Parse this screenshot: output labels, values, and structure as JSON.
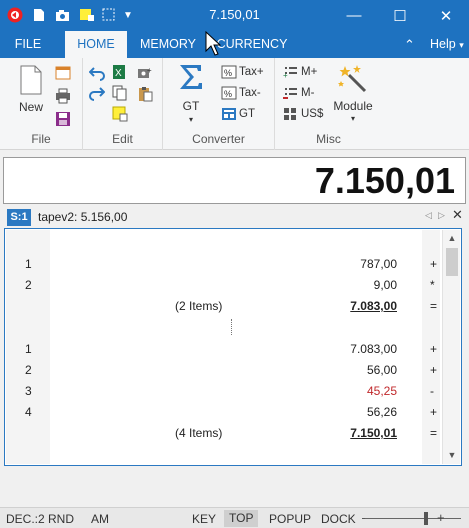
{
  "window": {
    "title": "7.150,01",
    "minimize": "—",
    "maximize": "☐",
    "close": "✕"
  },
  "quick_access": [
    "new-doc",
    "camera",
    "sticky-note",
    "select",
    "dropdown"
  ],
  "menu": {
    "tabs": [
      {
        "label": "FILE",
        "active": false
      },
      {
        "label": "HOME",
        "active": true
      },
      {
        "label": "MEMORY",
        "active": false
      },
      {
        "label": "CURRENCY",
        "active": false
      }
    ],
    "collapse_glyph": "⌃",
    "help": "Help",
    "help_caret": "▾"
  },
  "ribbon": {
    "file": {
      "label": "File",
      "new_label": "New"
    },
    "edit": {
      "label": "Edit"
    },
    "converter": {
      "label": "Converter",
      "gt_label": "GT",
      "caret": "▾",
      "tax_plus": "Tax+",
      "tax_minus": "Tax-",
      "gt_small": "GT"
    },
    "misc": {
      "label": "Misc",
      "m_plus": "M+",
      "m_minus": "M-",
      "uss": "US$",
      "module_label": "Module",
      "caret": "▾"
    }
  },
  "display": {
    "value": "7.150,01"
  },
  "tape": {
    "badge": "S:1",
    "name": "tapev2: 5.156,00",
    "rows": [
      {
        "num": "1",
        "label": "",
        "amount": "787,00",
        "op": "+",
        "kind": "normal"
      },
      {
        "num": "2",
        "label": "",
        "amount": "9,00",
        "op": "*",
        "kind": "normal"
      },
      {
        "num": "",
        "label": "(2 Items)",
        "amount": "7.083,00",
        "op": "=",
        "kind": "total"
      },
      {
        "num": "1",
        "label": "",
        "amount": "7.083,00",
        "op": "+",
        "kind": "normal"
      },
      {
        "num": "2",
        "label": "",
        "amount": "56,00",
        "op": "+",
        "kind": "normal"
      },
      {
        "num": "3",
        "label": "",
        "amount": "45,25",
        "op": "-",
        "kind": "neg"
      },
      {
        "num": "4",
        "label": "",
        "amount": "56,26",
        "op": "+",
        "kind": "normal"
      },
      {
        "num": "",
        "label": "(4 Items)",
        "amount": "7.150,01",
        "op": "=",
        "kind": "total"
      }
    ]
  },
  "status": {
    "dec": "DEC.:2",
    "rnd": "RND",
    "am": "AM",
    "key": "KEY",
    "top": "TOP",
    "popup": "POPUP",
    "dock": "DOCK",
    "minus": "—",
    "plus": "+"
  },
  "colors": {
    "accent": "#1e72c0",
    "negative": "#c0282b"
  }
}
